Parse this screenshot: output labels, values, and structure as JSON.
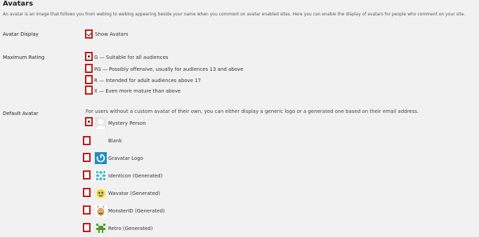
{
  "section": {
    "title": "Avatars",
    "intro": "An avatar is an image that follows you from weblog to weblog appearing beside your name when you comment on avatar enabled sites. Here you can enable the display of avatars for people who comment on your site."
  },
  "avatar_display": {
    "label": "Avatar Display",
    "checkbox_label": "Show Avatars",
    "checked": true
  },
  "maximum_rating": {
    "label": "Maximum Rating",
    "selected": "G",
    "options": [
      {
        "value": "G",
        "label": "G — Suitable for all audiences"
      },
      {
        "value": "PG",
        "label": "PG — Possibly offensive, usually for audiences 13 and above"
      },
      {
        "value": "R",
        "label": "R — Intended for adult audiences above 17"
      },
      {
        "value": "X",
        "label": "X — Even more mature than above"
      }
    ]
  },
  "default_avatar": {
    "label": "Default Avatar",
    "description": "For users without a custom avatar of their own, you can either display a generic logo or a generated one based on their email address.",
    "selected": "Mystery Person",
    "options": [
      {
        "label": "Mystery Person",
        "icon": "mystery-person-icon"
      },
      {
        "label": "Blank",
        "icon": "blank-avatar-icon"
      },
      {
        "label": "Gravatar Logo",
        "icon": "gravatar-logo-icon"
      },
      {
        "label": "Identicon (Generated)",
        "icon": "identicon-icon"
      },
      {
        "label": "Wavatar (Generated)",
        "icon": "wavatar-icon"
      },
      {
        "label": "MonsterID (Generated)",
        "icon": "monsterid-icon"
      },
      {
        "label": "Retro (Generated)",
        "icon": "retro-icon"
      }
    ]
  },
  "colors": {
    "highlight_border": "#c01414",
    "page_background": "#f1f1f1",
    "gravatar_blue": "#1e8cbe"
  }
}
